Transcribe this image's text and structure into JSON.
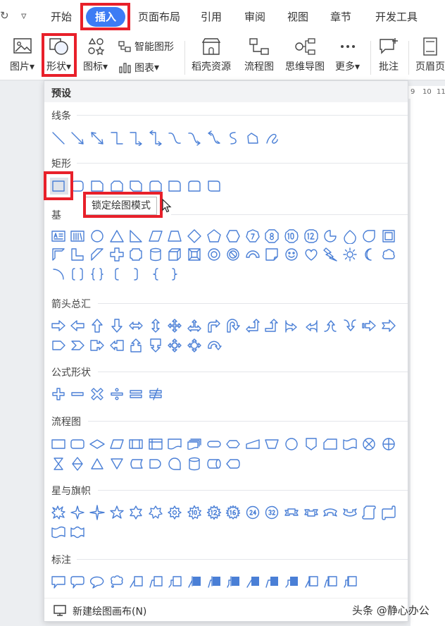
{
  "menu": {
    "tabs": [
      "开始",
      "插入",
      "页面布局",
      "引用",
      "审阅",
      "视图",
      "章节",
      "开发工具"
    ],
    "active_tab": "插入"
  },
  "ribbon": {
    "picture": "图片",
    "shape": "形状",
    "icon": "图标",
    "smart_art": "智能图形",
    "chart": "图表",
    "shell_resources": "稻壳资源",
    "flowchart": "流程图",
    "mindmap": "思维导图",
    "more": "更多",
    "comment": "批注",
    "header_footer": "页眉页"
  },
  "ruler": [
    "9",
    "10",
    "11"
  ],
  "panel": {
    "title": "预设",
    "sections": {
      "lines": "线条",
      "rect": "矩形",
      "basic": "基",
      "arrows": "箭头总汇",
      "formula": "公式形状",
      "flow": "流程图",
      "stars": "星与旗帜",
      "callouts": "标注"
    },
    "tooltip": "锁定绘图模式",
    "footer_action": "新建绘图画布(N)"
  },
  "watermark": "头条 @静心办公",
  "colors": {
    "accent": "#3d7cf4",
    "shape_stroke": "#4a7fd6",
    "highlight": "#e8202a"
  }
}
